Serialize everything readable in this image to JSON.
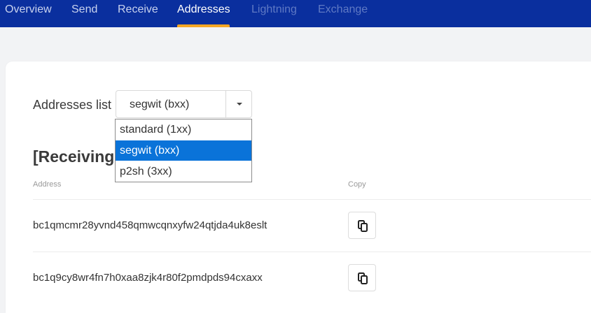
{
  "nav": {
    "tabs": [
      {
        "label": "Overview",
        "state": "normal"
      },
      {
        "label": "Send",
        "state": "normal"
      },
      {
        "label": "Receive",
        "state": "normal"
      },
      {
        "label": "Addresses",
        "state": "active"
      },
      {
        "label": "Lightning",
        "state": "disabled"
      },
      {
        "label": "Exchange",
        "state": "disabled"
      }
    ],
    "bar_color": "#0a2f9e",
    "active_underline_color": "#f6a623"
  },
  "addresses_list": {
    "label": "Addresses list",
    "selected": "segwit (bxx)",
    "options": [
      "standard (1xx)",
      "segwit (bxx)",
      "p2sh (3xx)"
    ],
    "highlight_color": "#0a73d9"
  },
  "section": {
    "title": "[Receiving"
  },
  "table": {
    "headers": {
      "address": "Address",
      "copy": "Copy"
    },
    "rows": [
      {
        "address": "bc1qmcmr28yvnd458qmwcqnxyfw24qtjda4uk8eslt",
        "copy_icon": "copy-icon"
      },
      {
        "address": "bc1q9cy8wr4fn7h0xaa8zjk4r80f2pmdpds94cxaxx",
        "copy_icon": "copy-icon"
      }
    ]
  }
}
